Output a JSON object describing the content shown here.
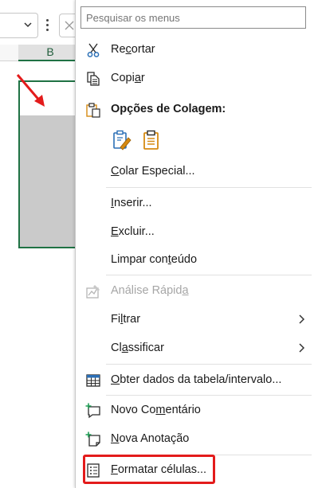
{
  "search": {
    "placeholder": "Pesquisar os menus"
  },
  "sheet": {
    "column_label": "B"
  },
  "paste_section_title": "Opções de Colagem:",
  "menu": {
    "cut": {
      "pre": "Re",
      "key": "c",
      "post": "ortar"
    },
    "copy": {
      "pre": "Copi",
      "key": "a",
      "post": "r"
    },
    "paste_special": {
      "pre": "",
      "key": "C",
      "post": "olar Especial..."
    },
    "insert": {
      "pre": "",
      "key": "I",
      "post": "nserir..."
    },
    "delete": {
      "pre": "",
      "key": "E",
      "post": "xcluir..."
    },
    "clear": {
      "pre": "Limpar con",
      "key": "t",
      "post": "eúdo"
    },
    "quick_analysis": {
      "pre": "Análise Rápid",
      "key": "a",
      "post": ""
    },
    "filter": {
      "pre": "Fi",
      "key": "l",
      "post": "trar"
    },
    "sort": {
      "pre": "Cl",
      "key": "a",
      "post": "ssificar"
    },
    "get_data": {
      "pre": "",
      "key": "O",
      "post": "bter dados da tabela/intervalo..."
    },
    "new_comment": {
      "pre": "Novo Co",
      "key": "m",
      "post": "entário"
    },
    "new_note": {
      "pre": "",
      "key": "N",
      "post": "ova Anotação"
    },
    "format_cells": {
      "pre": "",
      "key": "F",
      "post": "ormatar células..."
    }
  },
  "icons": {
    "cut": "scissors-icon",
    "copy": "copy-icon",
    "paste": "clipboard-icon",
    "quick_analysis": "quick-analysis-icon",
    "get_data": "table-icon",
    "new_comment": "comment-icon",
    "new_note": "note-icon",
    "format_cells": "format-cells-icon"
  },
  "colors": {
    "excel_green": "#1f7244",
    "icon_blue": "#2b6fb6",
    "icon_orange": "#d68a12",
    "highlight_red": "#e31b1b",
    "arrow_red": "#e31b1b"
  }
}
